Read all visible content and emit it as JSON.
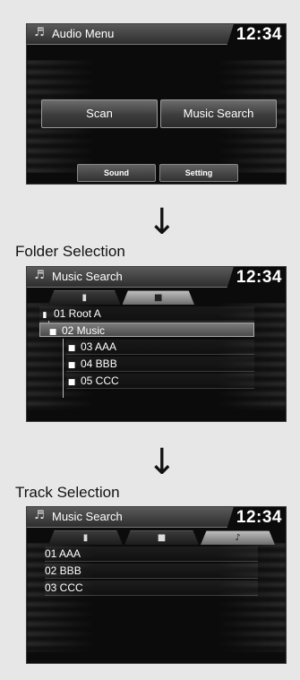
{
  "screen1": {
    "title": "Audio Menu",
    "clock": "12:34",
    "title_icon": "music-note-icon",
    "buttons": {
      "scan": "Scan",
      "music_search": "Music Search"
    },
    "soft_buttons": {
      "sound": "Sound",
      "setting": "Setting"
    }
  },
  "arrow": "↓",
  "label_folder": "Folder Selection",
  "label_track": "Track Selection",
  "screen2": {
    "title": "Music Search",
    "clock": "12:34",
    "tabs": [
      {
        "icon": "device-icon",
        "glyph": "▮"
      },
      {
        "icon": "folder-icon",
        "glyph": "■"
      }
    ],
    "rows": [
      {
        "icon": "device-icon",
        "glyph": "▮",
        "label": "01 Root A"
      },
      {
        "icon": "folder-icon",
        "glyph": "■",
        "label": "02 Music"
      },
      {
        "icon": "folder-icon",
        "glyph": "■",
        "label": "03 AAA"
      },
      {
        "icon": "folder-icon",
        "glyph": "■",
        "label": "04 BBB"
      },
      {
        "icon": "folder-icon",
        "glyph": "■",
        "label": "05 CCC"
      }
    ]
  },
  "screen3": {
    "title": "Music Search",
    "clock": "12:34",
    "tabs": [
      {
        "icon": "device-icon",
        "glyph": "▮"
      },
      {
        "icon": "folder-icon",
        "glyph": "■"
      },
      {
        "icon": "music-note-icon",
        "glyph": "♪"
      }
    ],
    "tracks": [
      "01 AAA",
      "02 BBB",
      "03 CCC"
    ]
  }
}
